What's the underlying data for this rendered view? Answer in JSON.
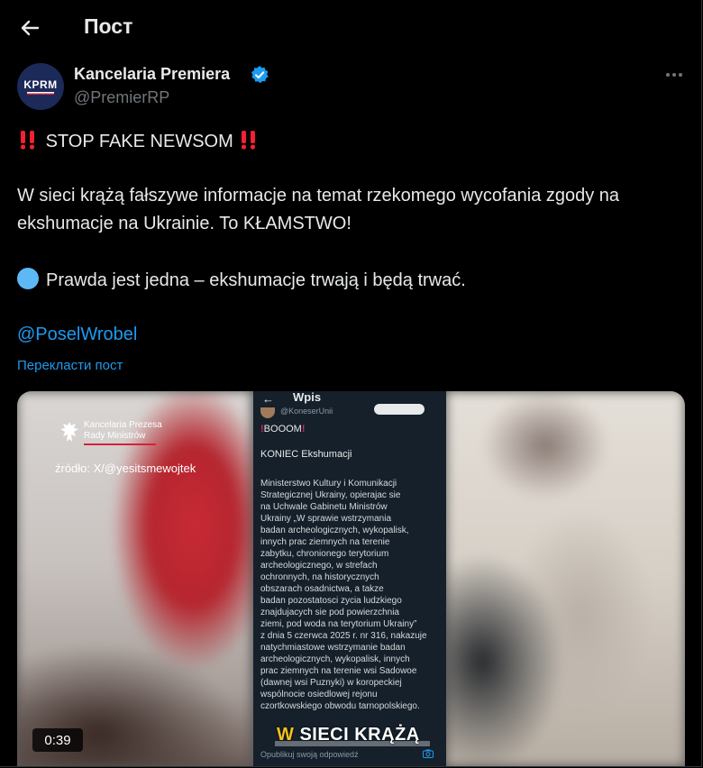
{
  "header": {
    "title": "Пост"
  },
  "author": {
    "avatar_text": "KPRM",
    "name": "Kancelaria Premiera",
    "handle": "@PremierRP"
  },
  "post": {
    "line1": "STOP FAKE NEWSOM",
    "line2": "W sieci krążą fałszywe informacje na temat rzekomego wycofania zgody na ekshumacje na Ukrainie. To KŁAMSTWO!",
    "line3": "Prawda jest jedna – ekshumacje trwają i będą trwać.",
    "mention": "@PoselWrobel",
    "translate": "Перекласти пост"
  },
  "media": {
    "logo_line1": "Kancelaria Prezesa",
    "logo_line2": "Rady Ministrów",
    "source": "źródło: X/@yesitsmewojtek",
    "phone_title": "Wpis",
    "phone_handle": "@KoneserUnii",
    "phone_booom": "BOOOM",
    "phone_heading": "KONIEC Ekshumacji",
    "phone_body": "Ministerstwo Kultury i Komunikacji\nStrategicznej Ukrainy, opierajac sie\nna Uchwale Gabinetu Ministrów\nUkrainy „W sprawie wstrzymania\nbadan archeologicznych, wykopalisk,\ninnych prac ziemnych na terenie\nzabytku, chronionego terytorium\narcheologicznego, w strefach\nochronnych, na historycznych\nobszarach osadnictwa, a takze\nbadan pozostatosci zycia ludzkiego\nznajdujacych sie pod powierzchnia\nziemi, pod woda na terytorium Ukrainy”\nz dnia 5 czerwca 2025 r. nr 316, nakazuje\nnatychmiastowe wstrzymanie badan\narcheologicznych, wykopalisk, innych\nprac ziemnych na terenie wsi Sadowoe\n(dawnej wsi Puznyki) w koropeckiej\nwspólnocie osiedlowej rejonu\nczortkowskiego obwodu tarnopolskiego.",
    "caption_w": "W",
    "caption_rest": " SIECI KRĄŻĄ",
    "phone_reply": "Opublikuj swoją odpowiedź",
    "duration": "0:39"
  },
  "colors": {
    "background": "#000000",
    "text": "#e7e9ea",
    "muted": "#71767b",
    "link": "#1d9bf0",
    "alert_red": "#f4212e",
    "blue_circle": "#5db8f5"
  },
  "icons": [
    "back-arrow-icon",
    "verified-badge-icon",
    "more-options-icon",
    "double-exclamation-icon",
    "blue-circle-icon",
    "eagle-emblem-icon",
    "camera-icon"
  ]
}
